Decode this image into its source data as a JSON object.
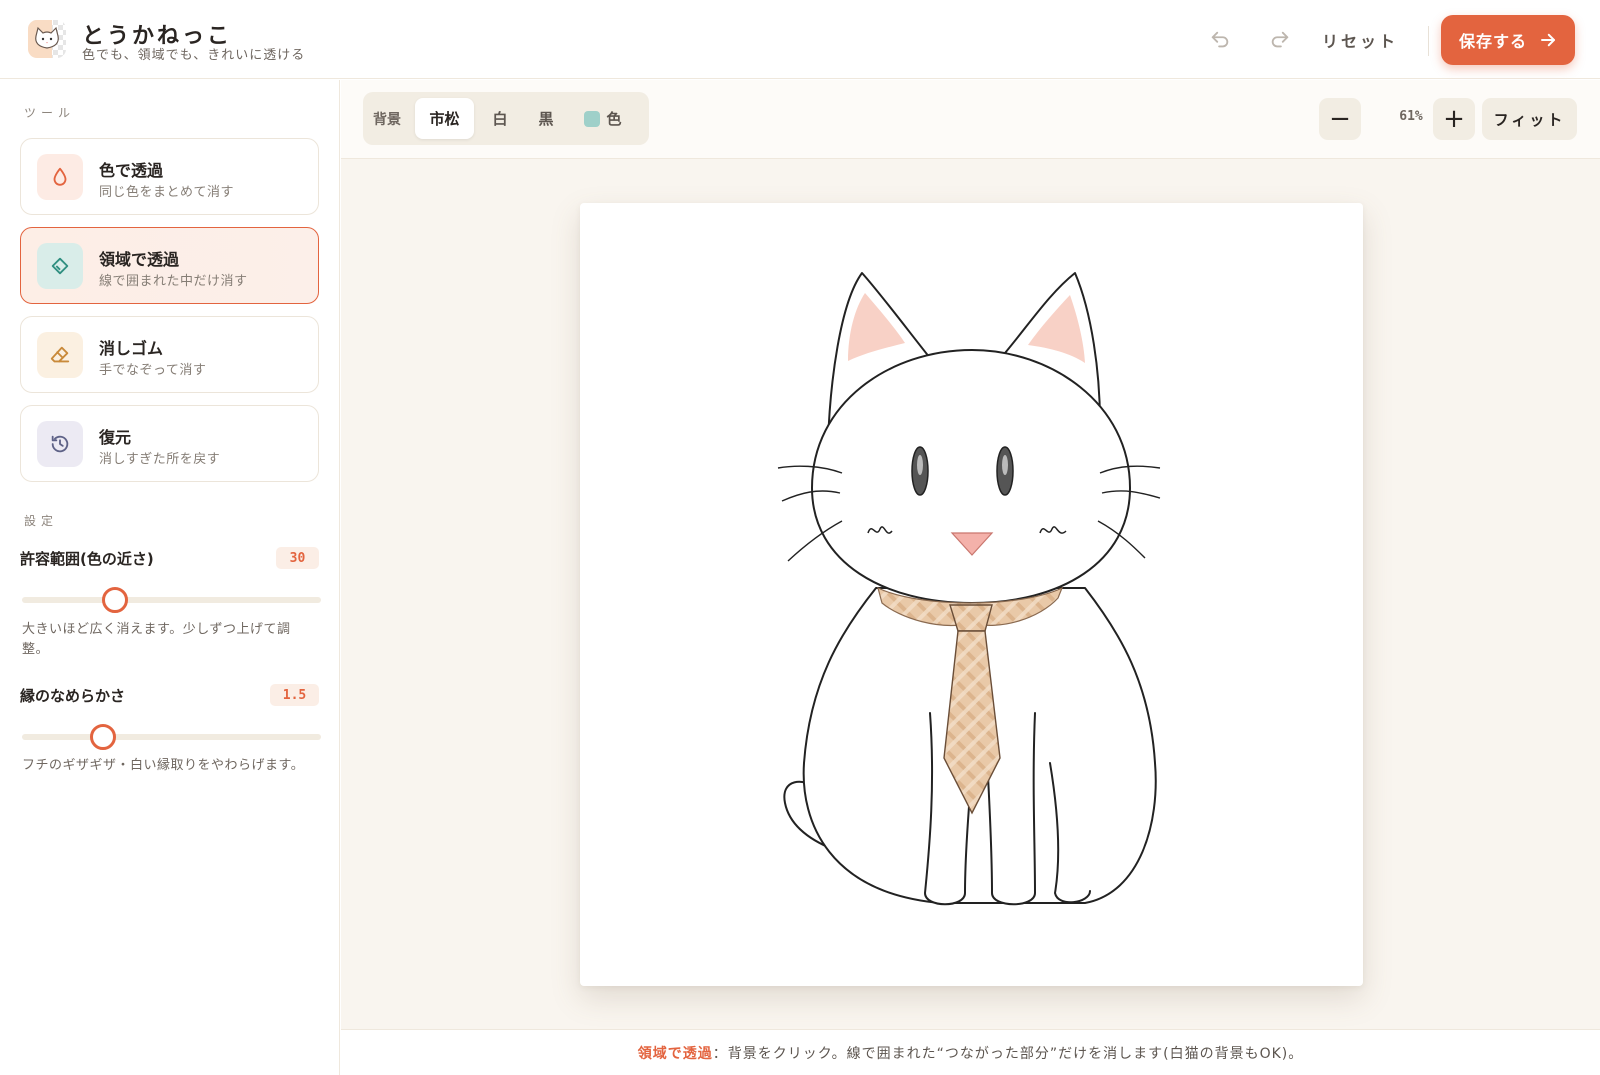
{
  "app": {
    "title": "とうかねっこ",
    "subtitle": "色でも、領域でも、きれいに透ける"
  },
  "header": {
    "undo_icon": "undo-icon",
    "redo_icon": "redo-icon",
    "reset_label": "リセット",
    "save_label": "保存する"
  },
  "sidebar": {
    "tools_heading": "ツール",
    "tools": [
      {
        "name": "色で透過",
        "desc": "同じ色をまとめて消す",
        "icon": "drop-icon",
        "active": false
      },
      {
        "name": "領域で透過",
        "desc": "線で囲まれた中だけ消す",
        "icon": "paint-bucket-icon",
        "active": true
      },
      {
        "name": "消しゴム",
        "desc": "手でなぞって消す",
        "icon": "eraser-icon",
        "active": false
      },
      {
        "name": "復元",
        "desc": "消しすぎた所を戻す",
        "icon": "history-icon",
        "active": false
      }
    ],
    "settings_heading": "設定",
    "settings": [
      {
        "name": "許容範囲(色の近さ)",
        "value": "30",
        "fraction": 0.31,
        "help": "大きいほど広く消えます。少しずつ上げて調整。"
      },
      {
        "name": "縁のなめらかさ",
        "value": "1.5",
        "fraction": 0.27,
        "help": "フチのギザギザ・白い縁取りをやわらげます。"
      }
    ]
  },
  "toolbar": {
    "bg_label": "背景",
    "bg_options": [
      "市松",
      "白",
      "黒",
      "色"
    ],
    "bg_selected": "市松",
    "bg_color_swatch": "#9fd0c9",
    "zoom_out": "−",
    "zoom_value": "61%",
    "zoom_in": "+",
    "fit_label": "フィット"
  },
  "status": {
    "mode": "領域で透過",
    "message": "：背景をクリック。線で囲まれた“つながった部分”だけを消します(白猫の背景もOK)。"
  },
  "colors": {
    "accent": "#e3643f",
    "active_bg": "#fdeee6"
  }
}
